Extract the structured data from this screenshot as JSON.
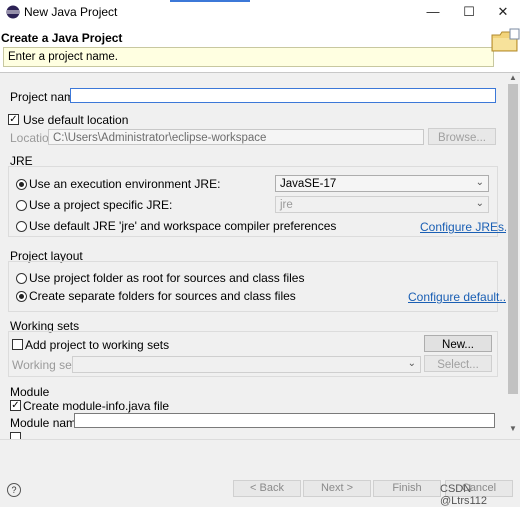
{
  "window": {
    "title": "New Java Project",
    "minimize": "—",
    "maximize": "☐",
    "close": "✕"
  },
  "header": {
    "title": "Create a Java Project",
    "message": "Enter a project name."
  },
  "project_name": {
    "label": "Project name:",
    "value": ""
  },
  "use_default_location": {
    "label": "Use default location",
    "checked": true
  },
  "location": {
    "label": "Location:",
    "value": "C:\\Users\\Administrator\\eclipse-workspace",
    "browse": "Browse..."
  },
  "jre": {
    "title": "JRE",
    "option1": "Use an execution environment JRE:",
    "option1_value": "JavaSE-17",
    "option2": "Use a project specific JRE:",
    "option2_value": "jre",
    "option3": "Use default JRE 'jre' and workspace compiler preferences",
    "configure_link": "Configure JREs...",
    "selected": "option1"
  },
  "project_layout": {
    "title": "Project layout",
    "option1": "Use project folder as root for sources and class files",
    "option2": "Create separate folders for sources and class files",
    "configure_link": "Configure default...",
    "selected": "option2"
  },
  "working_sets": {
    "title": "Working sets",
    "add_label": "Add project to working sets",
    "new_button": "New...",
    "sets_label": "Working sets:",
    "select_button": "Select..."
  },
  "module": {
    "title": "Module",
    "create_label": "Create module-info.java file",
    "name_label": "Module name:",
    "name_value": ""
  },
  "footer": {
    "help": "?",
    "back": "< Back",
    "next": "Next >",
    "finish": "Finish",
    "cancel": "Cancel"
  },
  "watermark": "CSDN @Ltrs112",
  "colors": {
    "accent": "#3c78d8",
    "link": "#1a5fb4",
    "message_bg": "#ffffe1"
  }
}
